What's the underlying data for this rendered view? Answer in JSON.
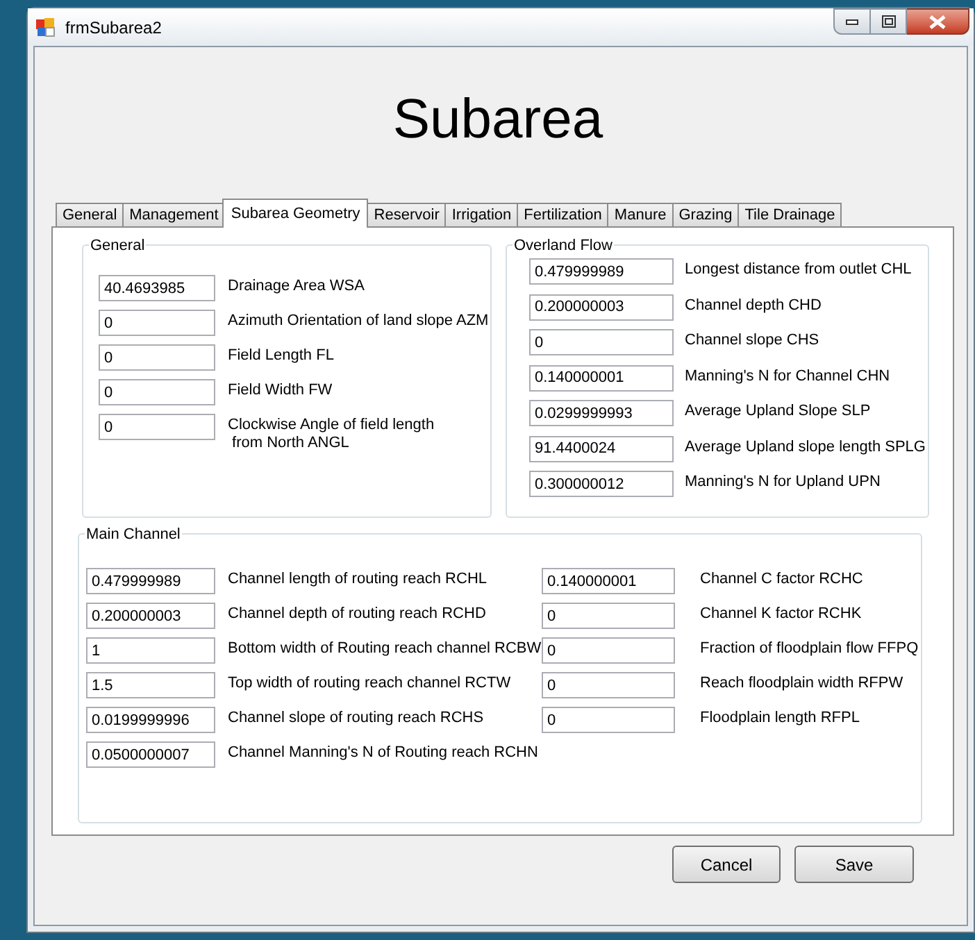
{
  "window": {
    "title": "frmSubarea2"
  },
  "heading": "Subarea",
  "tabs": [
    {
      "label": "General",
      "selected": false
    },
    {
      "label": "Management",
      "selected": false
    },
    {
      "label": "Subarea Geometry",
      "selected": true
    },
    {
      "label": "Reservoir",
      "selected": false
    },
    {
      "label": "Irrigation",
      "selected": false
    },
    {
      "label": "Fertilization",
      "selected": false
    },
    {
      "label": "Manure",
      "selected": false
    },
    {
      "label": "Grazing",
      "selected": false
    },
    {
      "label": "Tile Drainage",
      "selected": false
    }
  ],
  "general": {
    "title": "General",
    "fields": [
      {
        "value": "40.4693985",
        "label": "Drainage Area WSA"
      },
      {
        "value": "0",
        "label": "Azimuth Orientation of land slope AZM"
      },
      {
        "value": "0",
        "label": "Field Length FL"
      },
      {
        "value": "0",
        "label": "Field Width FW"
      },
      {
        "value": "0",
        "label": "Clockwise Angle of field length\n from North ANGL"
      }
    ]
  },
  "overland_flow": {
    "title": "Overland Flow",
    "fields": [
      {
        "value": "0.479999989",
        "label": "Longest distance from outlet CHL"
      },
      {
        "value": "0.200000003",
        "label": "Channel depth CHD"
      },
      {
        "value": "0",
        "label": "Channel slope CHS"
      },
      {
        "value": "0.140000001",
        "label": "Manning's N for Channel CHN"
      },
      {
        "value": "0.0299999993",
        "label": "Average Upland Slope SLP"
      },
      {
        "value": "91.4400024",
        "label": "Average Upland slope length SPLG"
      },
      {
        "value": "0.300000012",
        "label": "Manning's N for Upland UPN"
      }
    ]
  },
  "main_channel": {
    "title": "Main Channel",
    "left_fields": [
      {
        "value": "0.479999989",
        "label": "Channel length of routing reach RCHL"
      },
      {
        "value": "0.200000003",
        "label": "Channel depth of routing reach RCHD"
      },
      {
        "value": "1",
        "label": "Bottom width of Routing reach channel RCBW"
      },
      {
        "value": "1.5",
        "label": "Top width of routing reach channel RCTW"
      },
      {
        "value": "0.0199999996",
        "label": "Channel slope of routing reach RCHS"
      },
      {
        "value": "0.0500000007",
        "label": "Channel Manning's N of Routing reach RCHN"
      }
    ],
    "right_fields": [
      {
        "value": "0.140000001",
        "label": "Channel C factor RCHC"
      },
      {
        "value": "0",
        "label": "Channel K factor RCHK"
      },
      {
        "value": "0",
        "label": "Fraction of floodplain flow FFPQ"
      },
      {
        "value": "0",
        "label": "Reach floodplain width RFPW"
      },
      {
        "value": "0",
        "label": "Floodplain length RFPL"
      }
    ]
  },
  "buttons": [
    "Cancel",
    "Save"
  ]
}
